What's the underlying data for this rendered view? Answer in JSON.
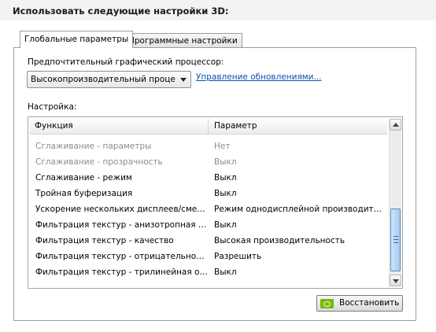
{
  "header": {
    "title": "Использовать следующие настройки 3D:"
  },
  "tabs": [
    {
      "label": "Глобальные параметры"
    },
    {
      "label": "Программные настройки"
    }
  ],
  "gpu": {
    "label": "Предпочтительный графический процессор:",
    "selected": "Высокопроизводительный процессор NVIDIA",
    "link": "Управление обновлениями..."
  },
  "settings": {
    "label": "Настройка:",
    "columns": [
      "Функция",
      "Параметр"
    ],
    "rows": [
      {
        "func": "Сглаживание - параметры",
        "param": "Нет"
      },
      {
        "func": "Сглаживание - прозрачность",
        "param": "Выкл"
      },
      {
        "func": "Сглаживание - режим",
        "param": "Выкл"
      },
      {
        "func": "Тройная буферизация",
        "param": "Выкл"
      },
      {
        "func": "Ускорение нескольких дисплеев/смешанных ГП",
        "param": "Режим однодисплейной производительности"
      },
      {
        "func": "Фильтрация текстур - анизотропная оптимизация",
        "param": "Выкл"
      },
      {
        "func": "Фильтрация текстур - качество",
        "param": "Высокая производительность"
      },
      {
        "func": "Фильтрация текстур - отрицательное отклонение УД",
        "param": "Разрешить"
      },
      {
        "func": "Фильтрация текстур - трилинейная оптимизация",
        "param": "Выкл"
      }
    ]
  },
  "restore": {
    "label": "Восстановить"
  },
  "colors": {
    "link": "#0b4fb8",
    "nvidia": "#76b900",
    "disabled_text": "#8c8c8c"
  }
}
